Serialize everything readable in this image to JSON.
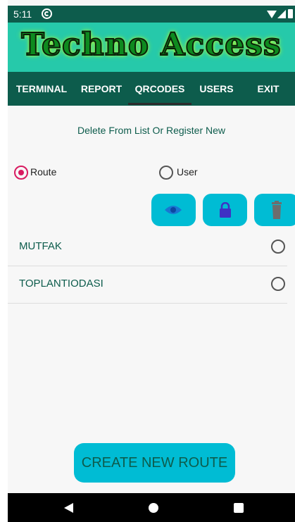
{
  "status": {
    "time": "5:11"
  },
  "banner": {
    "title": "Techno Access"
  },
  "nav": {
    "tabs": [
      "TERMINAL",
      "REPORT",
      "QRCODES",
      "USERS",
      "EXIT"
    ]
  },
  "page": {
    "subtitle": "Delete From List Or Register New",
    "radio_route": "Route",
    "radio_user": "User"
  },
  "list": {
    "items": [
      "MUTFAK",
      "TOPLANTIODASI"
    ]
  },
  "buttons": {
    "create": "CREATE NEW ROUTE"
  },
  "colors": {
    "accent": "#00bcd4",
    "primary_dark": "#0d5c4c",
    "banner_bg": "#26c9aa",
    "radio_selected": "#d81b60"
  },
  "icons": [
    "eye-icon",
    "lock-icon",
    "trash-icon",
    "back-icon",
    "home-icon",
    "recents-icon"
  ]
}
